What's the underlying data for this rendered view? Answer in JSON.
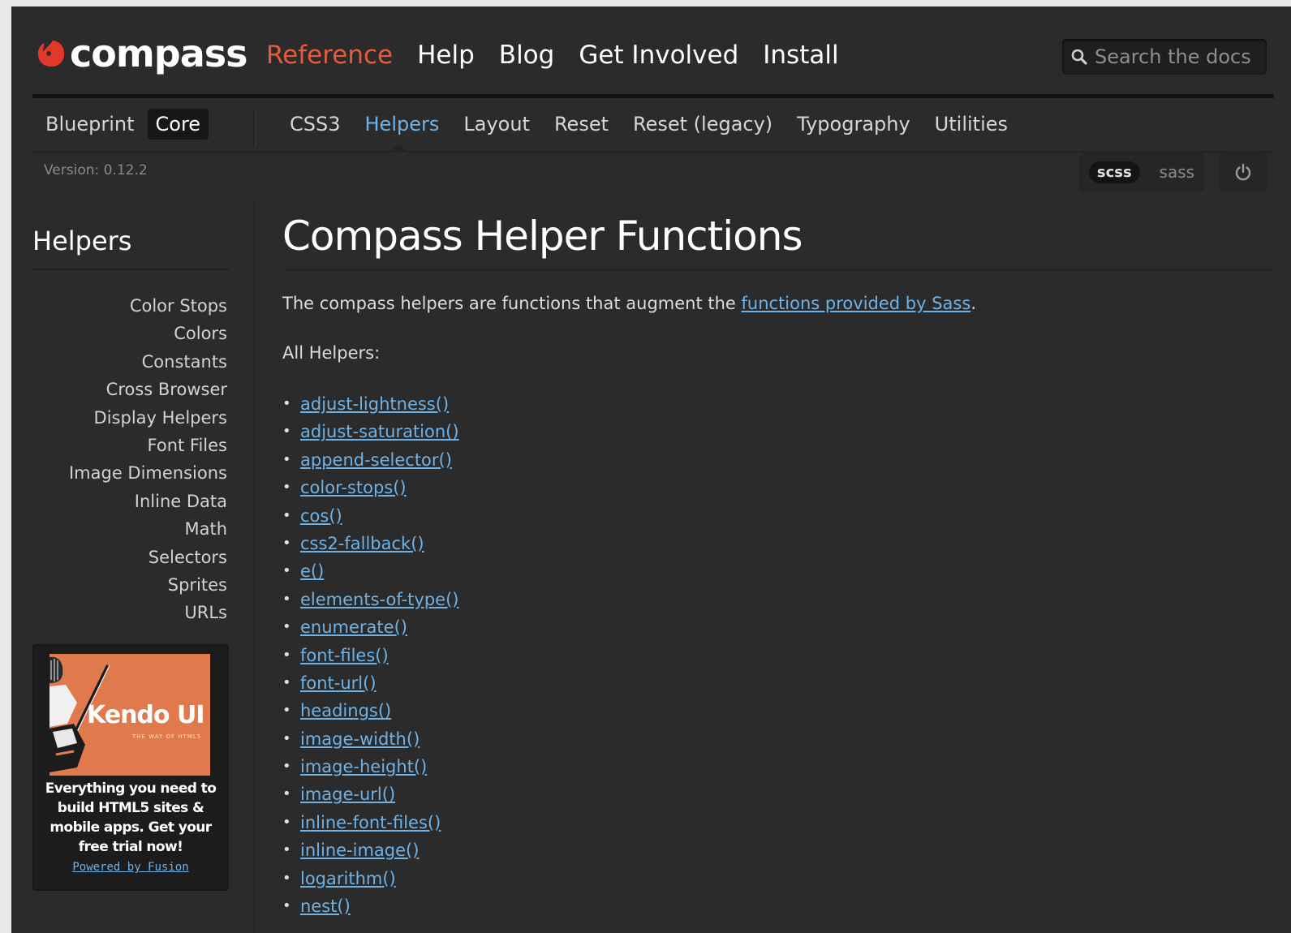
{
  "header": {
    "logo_text": "compass",
    "nav": [
      {
        "label": "Reference",
        "active": true
      },
      {
        "label": "Help",
        "active": false
      },
      {
        "label": "Blog",
        "active": false
      },
      {
        "label": "Get Involved",
        "active": false
      },
      {
        "label": "Install",
        "active": false
      }
    ],
    "search": {
      "placeholder": "Search the docs",
      "icon": "search-icon"
    }
  },
  "framework_tabs": [
    {
      "label": "Blueprint",
      "active": false
    },
    {
      "label": "Core",
      "active": true
    }
  ],
  "module_tabs": [
    {
      "label": "CSS3",
      "active": false
    },
    {
      "label": "Helpers",
      "active": true
    },
    {
      "label": "Layout",
      "active": false
    },
    {
      "label": "Reset",
      "active": false
    },
    {
      "label": "Reset (legacy)",
      "active": false
    },
    {
      "label": "Typography",
      "active": false
    },
    {
      "label": "Utilities",
      "active": false
    }
  ],
  "version_text": "Version: 0.12.2",
  "syntax": {
    "selected": "scss",
    "other": "sass",
    "power_icon": "power-icon"
  },
  "sidebar": {
    "title": "Helpers",
    "items": [
      "Color Stops",
      "Colors",
      "Constants",
      "Cross Browser",
      "Display Helpers",
      "Font Files",
      "Image Dimensions",
      "Inline Data",
      "Math",
      "Selectors",
      "Sprites",
      "URLs"
    ]
  },
  "ad": {
    "brand": "Kendo UI",
    "tagline": "THE WAY OF HTML5",
    "text": "Everything you need to build HTML5 sites & mobile apps. Get your free trial now!",
    "link": "Powered by Fusion"
  },
  "content": {
    "title": "Compass Helper Functions",
    "intro_before": "The compass helpers are functions that augment the ",
    "intro_link": "functions provided by Sass",
    "intro_after": ".",
    "all_label": "All Helpers:",
    "helpers": [
      "adjust-lightness()",
      "adjust-saturation()",
      "append-selector()",
      "color-stops()",
      "cos()",
      "css2-fallback()",
      "e()",
      "elements-of-type()",
      "enumerate()",
      "font-files()",
      "font-url()",
      "headings()",
      "image-width()",
      "image-height()",
      "image-url()",
      "inline-font-files()",
      "inline-image()",
      "logarithm()",
      "nest()"
    ]
  },
  "colors": {
    "accent": "#e85a3c",
    "link": "#6fb2e6",
    "background": "#2b2b2b"
  }
}
